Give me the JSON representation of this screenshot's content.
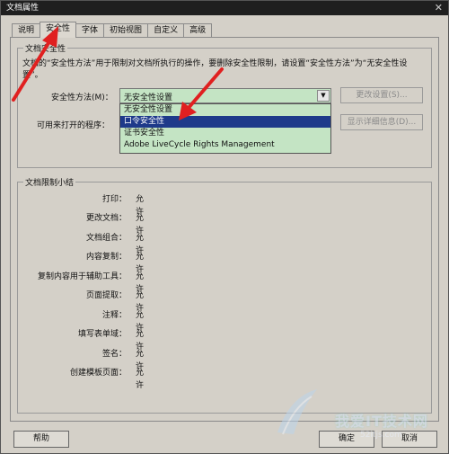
{
  "window": {
    "title": "文档属性"
  },
  "tabs": [
    {
      "label": "说明"
    },
    {
      "label": "安全性"
    },
    {
      "label": "字体"
    },
    {
      "label": "初始视图"
    },
    {
      "label": "自定义"
    },
    {
      "label": "高级"
    }
  ],
  "security_group": {
    "title": "文档安全性",
    "description": "文档的“安全性方法”用于限制对文档所执行的操作，要删除安全性限制，请设置“安全性方法”为“无安全性设置”。",
    "method_label": "安全性方法(M)：",
    "method_value": "无安全性设置",
    "change_button": "更改设置(S)...",
    "openable_label": "可用来打开的程序：",
    "details_button": "显示详细信息(D)...",
    "dropdown_options": [
      "无安全性设置",
      "口令安全性",
      "证书安全性",
      "Adobe LiveCycle Rights Management"
    ],
    "dropdown_selected_index": 1
  },
  "restrictions": {
    "title": "文档限制小结",
    "rows": [
      {
        "label": "打印：",
        "value": "允许"
      },
      {
        "label": "更改文档：",
        "value": "允许"
      },
      {
        "label": "文档组合：",
        "value": "允许"
      },
      {
        "label": "内容复制：",
        "value": "允许"
      },
      {
        "label": "复制内容用于辅助工具：",
        "value": "允许"
      },
      {
        "label": "页面提取：",
        "value": "允许"
      },
      {
        "label": "注释：",
        "value": "允许"
      },
      {
        "label": "填写表单域：",
        "value": "允许"
      },
      {
        "label": "签名：",
        "value": "允许"
      },
      {
        "label": "创建模板页面：",
        "value": "允许"
      }
    ]
  },
  "footer": {
    "help_button": "帮助",
    "ok_button": "确定",
    "cancel_button": "取消"
  },
  "watermark": {
    "text": "我爱IT技术网",
    "url": "52itjs.com"
  },
  "colors": {
    "combo_bg": "#c4e4c4",
    "selected_bg": "#1e3a8a",
    "annotation_arrow": "#e02020"
  }
}
